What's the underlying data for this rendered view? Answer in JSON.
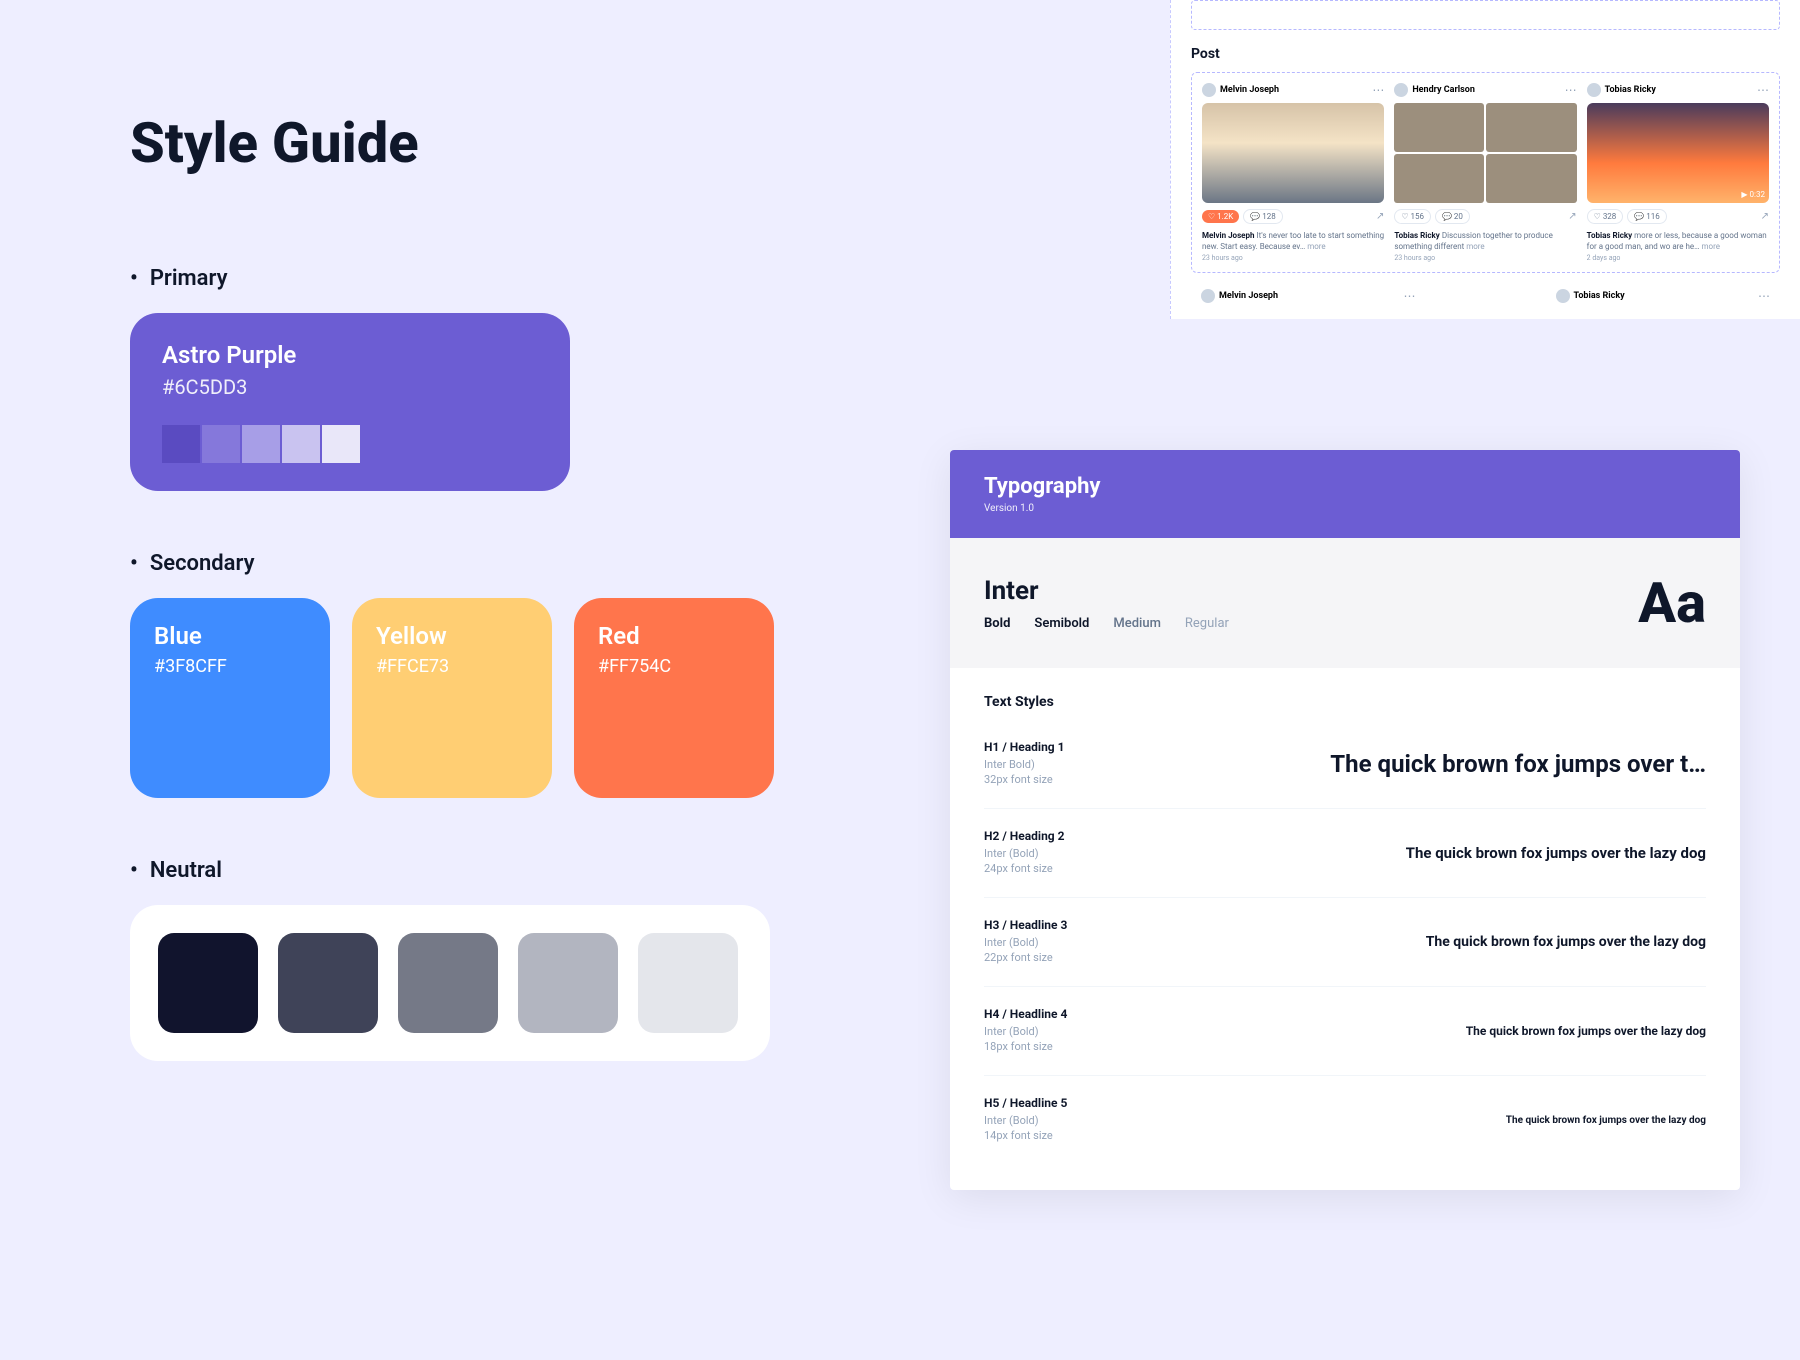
{
  "page_title": "Style Guide",
  "sections": {
    "primary": "Primary",
    "secondary": "Secondary",
    "neutral": "Neutral"
  },
  "colors": {
    "primary": {
      "name": "Astro Purple",
      "hex": "#6C5DD3",
      "tints": [
        "#5a4bc1",
        "#8578db",
        "#a79ee7",
        "#c9c3f0",
        "#e9e7f9"
      ]
    },
    "secondary": [
      {
        "name": "Blue",
        "hex": "#3F8CFF"
      },
      {
        "name": "Yellow",
        "hex": "#FFCE73"
      },
      {
        "name": "Red",
        "hex": "#FF754C"
      }
    ],
    "neutral": [
      "#11142d",
      "#3f4358",
      "#757987",
      "#b2b5c0",
      "#e4e6eb"
    ]
  },
  "posts": {
    "label": "Post",
    "items": [
      {
        "user": "Melvin Joseph",
        "likes": "1.2K",
        "comments": "128",
        "caption_bold": "Melvin Joseph",
        "caption": " It's never too late to start something new. Start easy. Because ev…",
        "time": "23 hours ago"
      },
      {
        "user": "Hendry Carlson",
        "likes": "156",
        "comments": "20",
        "caption_bold": "Tobias Ricky",
        "caption": " Discussion together to produce something different",
        "time": "23 hours ago"
      },
      {
        "user": "Tobias Ricky",
        "likes": "328",
        "comments": "116",
        "caption_bold": "Tobias Ricky",
        "caption": " more or less, because a good woman for a good man, and wo are he…",
        "time": "2 days ago"
      }
    ],
    "secondary_users": [
      "Melvin Joseph",
      "Tobias Ricky"
    ]
  },
  "typography": {
    "title": "Typography",
    "version": "Version 1.0",
    "font_name": "Inter",
    "weights": [
      "Bold",
      "Semibold",
      "Medium",
      "Regular"
    ],
    "big_sample": "Aa",
    "text_styles_label": "Text Styles",
    "styles": [
      {
        "name": "H1 / Heading 1",
        "sub1": "Inter Bold)",
        "sub2": "32px font size",
        "sample": "The quick brown fox jumps over t…",
        "size": 24
      },
      {
        "name": "H2 / Heading 2",
        "sub1": "Inter (Bold)",
        "sub2": "24px font size",
        "sample": "The quick brown fox jumps over the lazy dog",
        "size": 15
      },
      {
        "name": "H3 / Headline 3",
        "sub1": "Inter (Bold)",
        "sub2": "22px font size",
        "sample": "The quick brown fox jumps over the lazy dog",
        "size": 14
      },
      {
        "name": "H4 / Headline 4",
        "sub1": "Inter (Bold)",
        "sub2": "18px font size",
        "sample": "The quick brown fox jumps over the lazy dog",
        "size": 12
      },
      {
        "name": "H5 / Headline 5",
        "sub1": "Inter (Bold)",
        "sub2": "14px font size",
        "sample": "The quick brown fox jumps over the lazy dog",
        "size": 10
      }
    ]
  }
}
